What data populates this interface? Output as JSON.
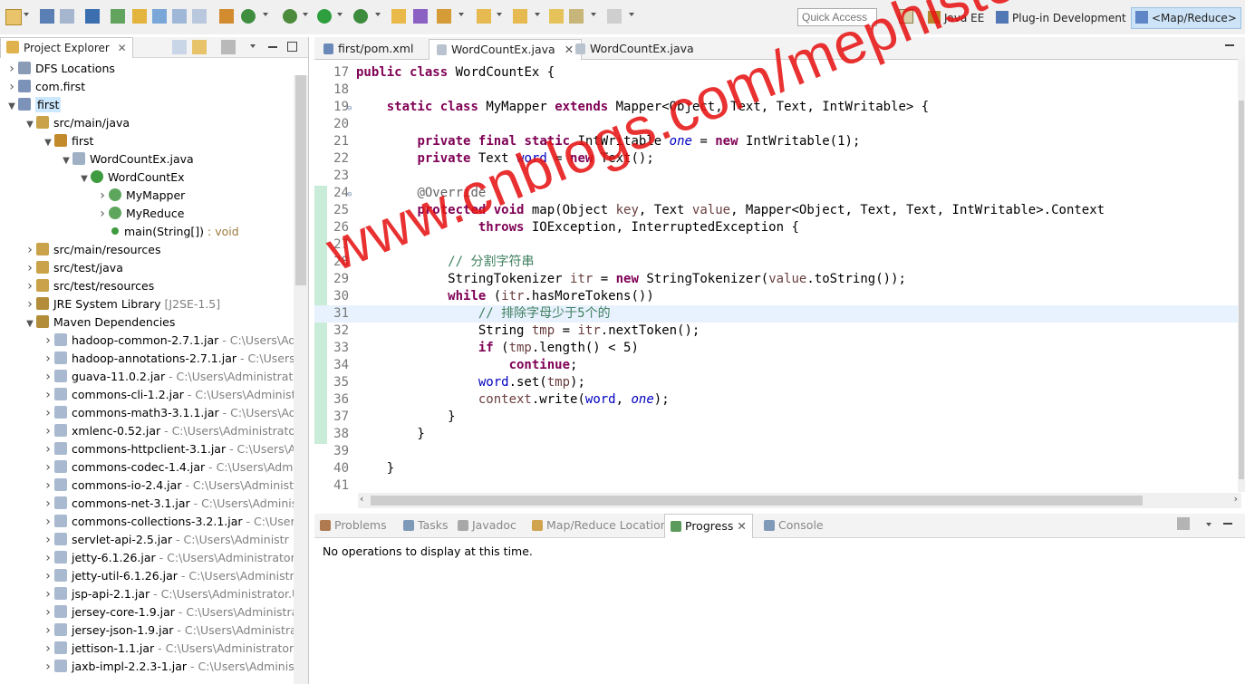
{
  "toolbar": {
    "quick_access_placeholder": "Quick Access",
    "perspectives": [
      {
        "label": "Java EE",
        "icon": "java-ee-perspective-icon"
      },
      {
        "label": "Plug-in Development",
        "icon": "plugin-perspective-icon"
      },
      {
        "label": "<Map/Reduce>",
        "icon": "elephant-icon",
        "active": true
      }
    ]
  },
  "explorer": {
    "title": "Project Explorer",
    "tree": [
      {
        "label": "DFS Locations",
        "decoration": "",
        "depth": 0,
        "icon": "dfs-icon",
        "twisty": "collapsed"
      },
      {
        "label": "com.first",
        "decoration": "",
        "depth": 0,
        "icon": "project-icon",
        "twisty": "collapsed"
      },
      {
        "label": "first",
        "decoration": "",
        "depth": 0,
        "icon": "project-icon",
        "twisty": "expanded",
        "selected": true
      },
      {
        "label": "src/main/java",
        "decoration": "",
        "depth": 1,
        "icon": "source-folder-icon",
        "twisty": "expanded"
      },
      {
        "label": "first",
        "decoration": "",
        "depth": 2,
        "icon": "package-icon",
        "twisty": "expanded"
      },
      {
        "label": "WordCountEx.java",
        "decoration": "",
        "depth": 3,
        "icon": "java-file-icon",
        "twisty": "expanded"
      },
      {
        "label": "WordCountEx",
        "decoration": "",
        "depth": 4,
        "icon": "class-icon",
        "twisty": "expanded"
      },
      {
        "label": "MyMapper",
        "decoration": "",
        "depth": 5,
        "icon": "inner-class-icon",
        "twisty": "collapsed"
      },
      {
        "label": "MyReduce",
        "decoration": "",
        "depth": 5,
        "icon": "inner-class-icon",
        "twisty": "collapsed"
      },
      {
        "label": "main(String[])",
        "decoration": " : void",
        "depth": 5,
        "icon": "method-icon",
        "twisty": "none"
      },
      {
        "label": "src/main/resources",
        "decoration": "",
        "depth": 1,
        "icon": "source-folder-icon",
        "twisty": "collapsed"
      },
      {
        "label": "src/test/java",
        "decoration": "",
        "depth": 1,
        "icon": "source-folder-icon",
        "twisty": "collapsed"
      },
      {
        "label": "src/test/resources",
        "decoration": "",
        "depth": 1,
        "icon": "source-folder-icon",
        "twisty": "collapsed"
      },
      {
        "label": "JRE System Library",
        "decoration": " [J2SE-1.5]",
        "depth": 1,
        "icon": "library-icon",
        "twisty": "collapsed"
      },
      {
        "label": "Maven Dependencies",
        "decoration": "",
        "depth": 1,
        "icon": "library-icon",
        "twisty": "expanded"
      },
      {
        "label": "hadoop-common-2.7.1.jar",
        "decoration": " - C:\\Users\\Adn",
        "depth": 2,
        "icon": "jar-icon",
        "twisty": "collapsed"
      },
      {
        "label": "hadoop-annotations-2.7.1.jar",
        "decoration": " - C:\\Users\\",
        "depth": 2,
        "icon": "jar-icon",
        "twisty": "collapsed"
      },
      {
        "label": "guava-11.0.2.jar",
        "decoration": " - C:\\Users\\Administrator",
        "depth": 2,
        "icon": "jar-icon",
        "twisty": "collapsed"
      },
      {
        "label": "commons-cli-1.2.jar",
        "decoration": " - C:\\Users\\Administr",
        "depth": 2,
        "icon": "jar-icon",
        "twisty": "collapsed"
      },
      {
        "label": "commons-math3-3.1.1.jar",
        "decoration": " - C:\\Users\\Adm",
        "depth": 2,
        "icon": "jar-icon",
        "twisty": "collapsed"
      },
      {
        "label": "xmlenc-0.52.jar",
        "decoration": " - C:\\Users\\Administrator.",
        "depth": 2,
        "icon": "jar-icon",
        "twisty": "collapsed"
      },
      {
        "label": "commons-httpclient-3.1.jar",
        "decoration": " - C:\\Users\\Ad",
        "depth": 2,
        "icon": "jar-icon",
        "twisty": "collapsed"
      },
      {
        "label": "commons-codec-1.4.jar",
        "decoration": " - C:\\Users\\Admin",
        "depth": 2,
        "icon": "jar-icon",
        "twisty": "collapsed"
      },
      {
        "label": "commons-io-2.4.jar",
        "decoration": " - C:\\Users\\Administr",
        "depth": 2,
        "icon": "jar-icon",
        "twisty": "collapsed"
      },
      {
        "label": "commons-net-3.1.jar",
        "decoration": " - C:\\Users\\Administ",
        "depth": 2,
        "icon": "jar-icon",
        "twisty": "collapsed"
      },
      {
        "label": "commons-collections-3.2.1.jar",
        "decoration": " - C:\\Users\\",
        "depth": 2,
        "icon": "jar-icon",
        "twisty": "collapsed"
      },
      {
        "label": "servlet-api-2.5.jar",
        "decoration": " - C:\\Users\\Administr",
        "depth": 2,
        "icon": "jar-icon",
        "twisty": "collapsed"
      },
      {
        "label": "jetty-6.1.26.jar",
        "decoration": " - C:\\Users\\Administrator.U",
        "depth": 2,
        "icon": "jar-icon",
        "twisty": "collapsed"
      },
      {
        "label": "jetty-util-6.1.26.jar",
        "decoration": " - C:\\Users\\Administrat",
        "depth": 2,
        "icon": "jar-icon",
        "twisty": "collapsed"
      },
      {
        "label": "jsp-api-2.1.jar",
        "decoration": " - C:\\Users\\Administrator.U",
        "depth": 2,
        "icon": "jar-icon",
        "twisty": "collapsed"
      },
      {
        "label": "jersey-core-1.9.jar",
        "decoration": " - C:\\Users\\Administrat",
        "depth": 2,
        "icon": "jar-icon",
        "twisty": "collapsed"
      },
      {
        "label": "jersey-json-1.9.jar",
        "decoration": " - C:\\Users\\Administrat",
        "depth": 2,
        "icon": "jar-icon",
        "twisty": "collapsed"
      },
      {
        "label": "jettison-1.1.jar",
        "decoration": " - C:\\Users\\Administrator.U",
        "depth": 2,
        "icon": "jar-icon",
        "twisty": "collapsed"
      },
      {
        "label": "jaxb-impl-2.2.3-1.jar",
        "decoration": " - C:\\Users\\Administr",
        "depth": 2,
        "icon": "jar-icon",
        "twisty": "collapsed"
      }
    ]
  },
  "editor": {
    "tabs": [
      {
        "label": "first/pom.xml",
        "icon": "maven-pom-icon"
      },
      {
        "label": "WordCountEx.java",
        "icon": "java-file-icon",
        "active": true
      },
      {
        "label": "WordCountEx.java",
        "icon": "java-file-icon"
      }
    ],
    "lines": [
      {
        "n": "17",
        "marker": "",
        "tokens": [
          {
            "t": "public",
            "c": "kw"
          },
          {
            "t": " "
          },
          {
            "t": "class",
            "c": "kw"
          },
          {
            "t": " WordCountEx {"
          }
        ]
      },
      {
        "n": "18",
        "marker": "",
        "tokens": []
      },
      {
        "n": "19",
        "marker": "⊖",
        "tokens": [
          {
            "t": "    "
          },
          {
            "t": "static",
            "c": "kw"
          },
          {
            "t": " "
          },
          {
            "t": "class",
            "c": "kw"
          },
          {
            "t": " MyMapper "
          },
          {
            "t": "extends",
            "c": "kw"
          },
          {
            "t": " Mapper<Object, Text, Text, IntWritable> {"
          }
        ]
      },
      {
        "n": "20",
        "marker": "",
        "tokens": []
      },
      {
        "n": "21",
        "marker": "",
        "tokens": [
          {
            "t": "        "
          },
          {
            "t": "private",
            "c": "kw"
          },
          {
            "t": " "
          },
          {
            "t": "final",
            "c": "kw"
          },
          {
            "t": " "
          },
          {
            "t": "static",
            "c": "kw"
          },
          {
            "t": " IntWritable "
          },
          {
            "t": "one",
            "c": "sfld"
          },
          {
            "t": " = "
          },
          {
            "t": "new",
            "c": "kw"
          },
          {
            "t": " IntWritable(1);"
          }
        ]
      },
      {
        "n": "22",
        "marker": "",
        "tokens": [
          {
            "t": "        "
          },
          {
            "t": "private",
            "c": "kw"
          },
          {
            "t": " Text "
          },
          {
            "t": "word",
            "c": "fld"
          },
          {
            "t": " = "
          },
          {
            "t": "new",
            "c": "kw"
          },
          {
            "t": " Text();"
          }
        ]
      },
      {
        "n": "23",
        "marker": "",
        "tokens": []
      },
      {
        "n": "24",
        "marker": "⊖",
        "tokens": [
          {
            "t": "        "
          },
          {
            "t": "@Override",
            "c": "ann"
          }
        ]
      },
      {
        "n": "25",
        "marker": "",
        "tokens": [
          {
            "t": "        "
          },
          {
            "t": "protected",
            "c": "kw"
          },
          {
            "t": " "
          },
          {
            "t": "void",
            "c": "kw"
          },
          {
            "t": " map(Object "
          },
          {
            "t": "key",
            "c": "ident"
          },
          {
            "t": ", Text "
          },
          {
            "t": "value",
            "c": "ident"
          },
          {
            "t": ", Mapper<Object, Text, Text, IntWritable>.Context"
          }
        ]
      },
      {
        "n": "26",
        "marker": "",
        "tokens": [
          {
            "t": "                "
          },
          {
            "t": "throws",
            "c": "kw"
          },
          {
            "t": " IOException, InterruptedException {"
          }
        ]
      },
      {
        "n": "27",
        "marker": "",
        "tokens": []
      },
      {
        "n": "28",
        "marker": "",
        "tokens": [
          {
            "t": "            "
          },
          {
            "t": "// 分割字符串",
            "c": "cmt"
          }
        ]
      },
      {
        "n": "29",
        "marker": "",
        "tokens": [
          {
            "t": "            StringTokenizer "
          },
          {
            "t": "itr",
            "c": "ident"
          },
          {
            "t": " = "
          },
          {
            "t": "new",
            "c": "kw"
          },
          {
            "t": " StringTokenizer("
          },
          {
            "t": "value",
            "c": "ident"
          },
          {
            "t": ".toString());"
          }
        ]
      },
      {
        "n": "30",
        "marker": "",
        "tokens": [
          {
            "t": "            "
          },
          {
            "t": "while",
            "c": "kw"
          },
          {
            "t": " ("
          },
          {
            "t": "itr",
            "c": "ident"
          },
          {
            "t": ".hasMoreTokens())"
          }
        ]
      },
      {
        "n": "31",
        "marker": "",
        "highlight": true,
        "tokens": [
          {
            "t": "                "
          },
          {
            "t": "// 排除字母少于5个的",
            "c": "cmt"
          }
        ]
      },
      {
        "n": "32",
        "marker": "",
        "tokens": [
          {
            "t": "                String "
          },
          {
            "t": "tmp",
            "c": "ident"
          },
          {
            "t": " = "
          },
          {
            "t": "itr",
            "c": "ident"
          },
          {
            "t": ".nextToken();"
          }
        ]
      },
      {
        "n": "33",
        "marker": "",
        "tokens": [
          {
            "t": "                "
          },
          {
            "t": "if",
            "c": "kw"
          },
          {
            "t": " ("
          },
          {
            "t": "tmp",
            "c": "ident"
          },
          {
            "t": ".length() < 5)"
          }
        ]
      },
      {
        "n": "34",
        "marker": "",
        "tokens": [
          {
            "t": "                    "
          },
          {
            "t": "continue",
            "c": "kw"
          },
          {
            "t": ";"
          }
        ]
      },
      {
        "n": "35",
        "marker": "",
        "tokens": [
          {
            "t": "                "
          },
          {
            "t": "word",
            "c": "fld"
          },
          {
            "t": ".set("
          },
          {
            "t": "tmp",
            "c": "ident"
          },
          {
            "t": ");"
          }
        ]
      },
      {
        "n": "36",
        "marker": "",
        "tokens": [
          {
            "t": "                "
          },
          {
            "t": "context",
            "c": "ident"
          },
          {
            "t": ".write("
          },
          {
            "t": "word",
            "c": "fld"
          },
          {
            "t": ", "
          },
          {
            "t": "one",
            "c": "sfld"
          },
          {
            "t": ");"
          }
        ]
      },
      {
        "n": "37",
        "marker": "",
        "tokens": [
          {
            "t": "            }"
          }
        ]
      },
      {
        "n": "38",
        "marker": "",
        "tokens": [
          {
            "t": "        }"
          }
        ]
      },
      {
        "n": "39",
        "marker": "",
        "tokens": []
      },
      {
        "n": "40",
        "marker": "",
        "tokens": [
          {
            "t": "    }"
          }
        ]
      },
      {
        "n": "41",
        "marker": "",
        "tokens": []
      }
    ]
  },
  "bottom": {
    "tabs": [
      {
        "label": "Problems",
        "icon": "problems-icon"
      },
      {
        "label": "Tasks",
        "icon": "tasks-icon"
      },
      {
        "label": "Javadoc",
        "icon": "javadoc-icon"
      },
      {
        "label": "Map/Reduce Locations",
        "icon": "mapreduce-locations-icon"
      },
      {
        "label": "Progress",
        "icon": "progress-icon",
        "active": true
      },
      {
        "label": "Console",
        "icon": "console-icon"
      }
    ],
    "message": "No operations to display at this time."
  },
  "watermark": "www.cnblogs.com/mephisto",
  "colors": {
    "keyword": "#7f0055",
    "field": "#0000c0",
    "comment": "#3f7f5f",
    "annotation": "#646464",
    "selection": "#cce8ff",
    "watermark": "#e61414"
  }
}
